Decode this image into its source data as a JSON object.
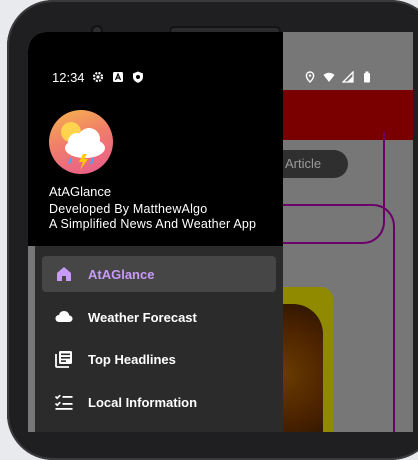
{
  "status_bar": {
    "time": "12:34",
    "left_icons": [
      "gear-icon",
      "font-a-icon",
      "shield-icon"
    ],
    "right_icons": [
      "location-icon",
      "wifi-icon",
      "signal-icon",
      "battery-icon"
    ]
  },
  "background_app": {
    "article_pill": "Article"
  },
  "drawer": {
    "app_name": "AtAGlance",
    "developer": "Developed By MatthewAlgo",
    "tagline": "A Simplified News And Weather App",
    "items": [
      {
        "label": "AtAGlance",
        "icon": "home-icon",
        "active": true
      },
      {
        "label": "Weather Forecast",
        "icon": "cloud-icon",
        "active": false
      },
      {
        "label": "Top Headlines",
        "icon": "news-icon",
        "active": false
      },
      {
        "label": "Local Information",
        "icon": "checklist-icon",
        "active": false
      }
    ]
  },
  "colors": {
    "active_item_text": "#c79bf7",
    "active_item_bg": "#464646",
    "drawer_body_bg": "#2b2b2b",
    "app_toolbar": "#7a0000",
    "frame_purple": "#6a006a"
  }
}
